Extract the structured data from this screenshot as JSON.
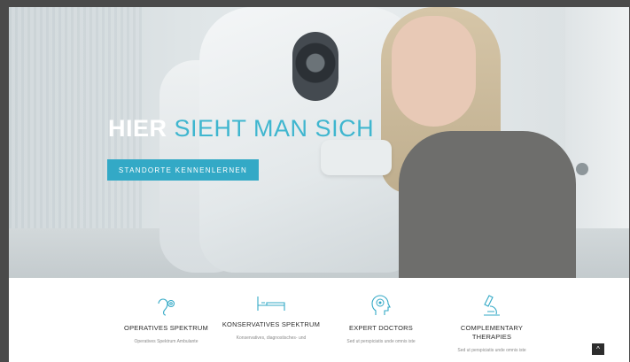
{
  "hero": {
    "title_part1": "HIER",
    "title_part2": "SIEHT MAN SICH",
    "cta_label": "STANDORTE KENNENLERNEN"
  },
  "features": [
    {
      "icon": "ear-icon",
      "title": "OPERATIVES SPEKTRUM",
      "text": "Operatives Spektrum Ambulante"
    },
    {
      "icon": "bed-icon",
      "title": "KONSERVATIVES SPEKTRUM",
      "text": "Konservatives, diagnostisches- und"
    },
    {
      "icon": "brain-head-icon",
      "title": "EXPERT DOCTORS",
      "text": "Sed ut perspiciatis unde omnis iste"
    },
    {
      "icon": "microscope-icon",
      "title": "COMPLEMENTARY THERAPIES",
      "text": "Sed ut perspiciatis unde omnis iste"
    }
  ],
  "scroll_top": {
    "icon": "chevron-up-icon",
    "label": "^"
  },
  "colors": {
    "accent": "#33a9c6",
    "accent_text": "#3fb6cf",
    "frame_bg": "#4a4a4a"
  }
}
